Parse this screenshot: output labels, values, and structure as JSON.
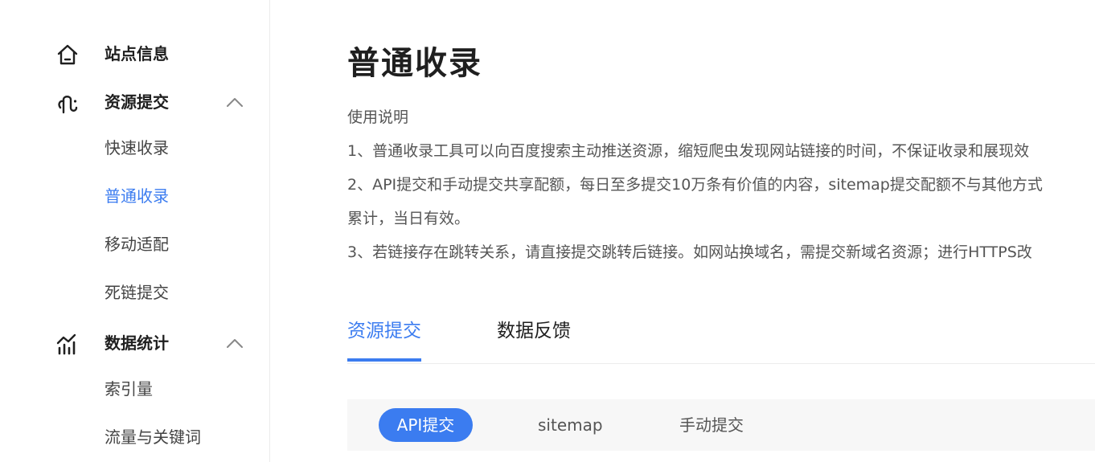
{
  "sidebar": {
    "site_info": {
      "label": "站点信息",
      "icon": "home-icon"
    },
    "resource_submit": {
      "label": "资源提交",
      "icon": "link-icon",
      "expanded": true,
      "items": [
        {
          "label": "快速收录"
        },
        {
          "label": "普通收录",
          "active": true
        },
        {
          "label": "移动适配"
        },
        {
          "label": "死链提交"
        }
      ]
    },
    "data_stats": {
      "label": "数据统计",
      "icon": "chart-icon",
      "expanded": true,
      "items": [
        {
          "label": "索引量"
        },
        {
          "label": "流量与关键词"
        }
      ]
    }
  },
  "main": {
    "title": "普通收录",
    "usage_heading": "使用说明",
    "usage_lines": [
      "1、普通收录工具可以向百度搜索主动推送资源，缩短爬虫发现网站链接的时间，不保证收录和展现效",
      "2、API提交和手动提交共享配额，每日至多提交10万条有价值的内容，sitemap提交配额不与其他方式",
      "累计，当日有效。",
      "3、若链接存在跳转关系，请直接提交跳转后链接。如网站换域名，需提交新域名资源；进行HTTPS改"
    ],
    "tabs": [
      {
        "label": "资源提交",
        "active": true
      },
      {
        "label": "数据反馈",
        "active": false
      }
    ],
    "submit_methods": [
      {
        "label": "API提交",
        "active": true
      },
      {
        "label": "sitemap",
        "active": false
      },
      {
        "label": "手动提交",
        "active": false
      }
    ]
  },
  "colors": {
    "accent": "#3b7cf0",
    "text_dark": "#1f1f1f",
    "text_body": "#555555",
    "subtab_bg": "#f7f7f7"
  }
}
